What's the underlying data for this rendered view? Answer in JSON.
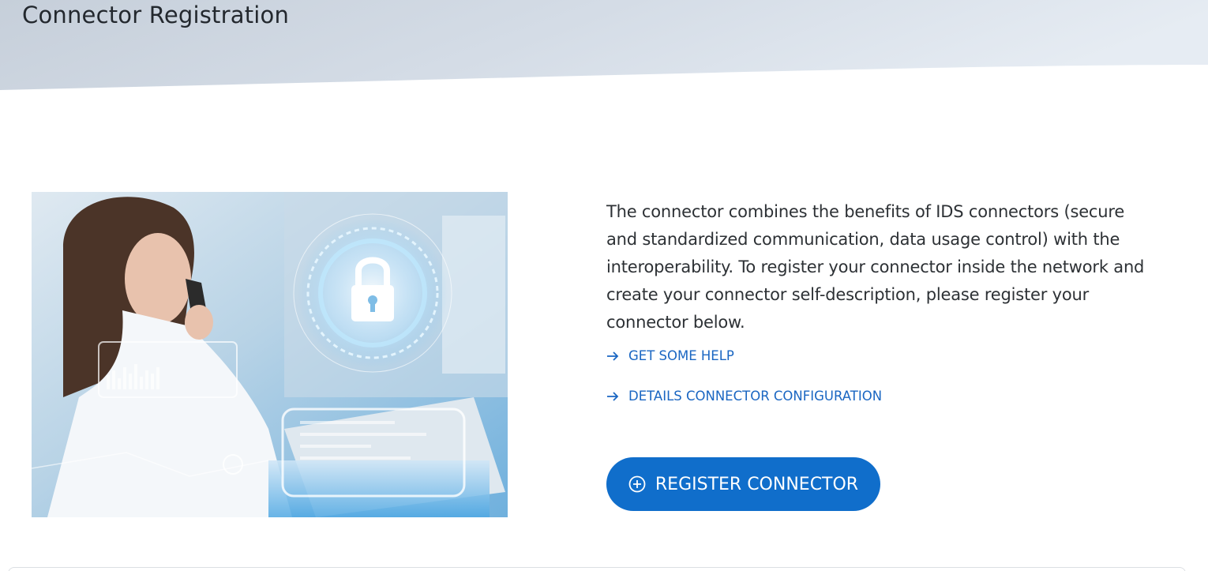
{
  "header": {
    "title": "Connector Registration"
  },
  "hero": {
    "image_alt": "Woman on phone using laptop with security padlock hologram"
  },
  "main": {
    "description": "The connector combines the benefits of IDS connectors (secure and standardized communication, data usage control) with the interoperability. To register your connector inside the network and create your connector self-description, please register your connector below.",
    "links": [
      {
        "label": "GET SOME HELP",
        "icon": "arrow-right-icon"
      },
      {
        "label": "DETAILS CONNECTOR CONFIGURATION",
        "icon": "arrow-right-icon"
      }
    ],
    "register_button": {
      "label": "REGISTER CONNECTOR",
      "icon": "plus-circle-icon"
    }
  },
  "colors": {
    "accent": "#106ecb",
    "link": "#1a66c2",
    "header_gradient_start": "#c7d0db",
    "header_gradient_end": "#e4eaf2"
  }
}
